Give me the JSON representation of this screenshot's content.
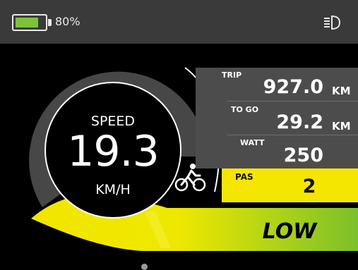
{
  "status_bar": {
    "battery_percent_text": "80%",
    "battery_level": 0.8,
    "headlight_icon": "headlight-icon"
  },
  "trip": {
    "label": "TRIP",
    "value": "927.0",
    "unit": "KM"
  },
  "to_go": {
    "label": "TO GO",
    "value": "29.2",
    "unit": "KM"
  },
  "watt": {
    "label": "WATT",
    "value": "250"
  },
  "pas": {
    "label": "PAS",
    "value": "2"
  },
  "mode": {
    "label": "LOW"
  },
  "speed": {
    "title": "SPEED",
    "value": "19.3",
    "unit": "KM/H"
  },
  "assist_icon": "bicycle-rider-icon",
  "colors": {
    "battery_green": "#7cc23a",
    "pas_yellow": "#f4e600",
    "gradient_start": "#f2e600",
    "gradient_end": "#7cc02a",
    "panel_grey": "#4c4c4c"
  }
}
